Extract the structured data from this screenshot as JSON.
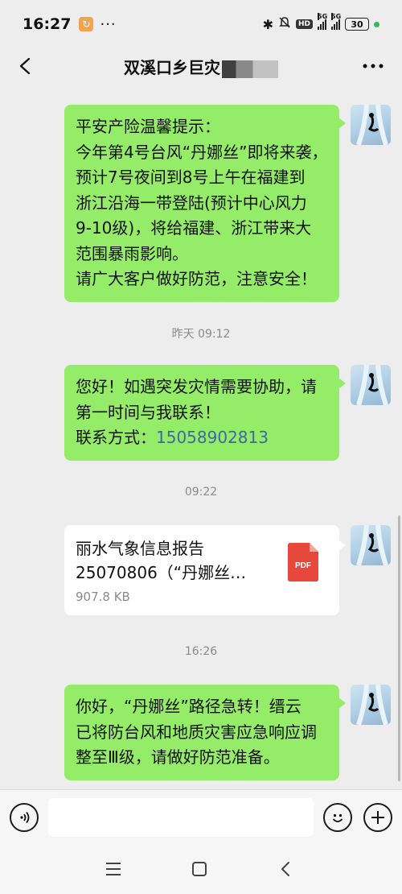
{
  "status_bar": {
    "time": "16:27",
    "dots": "···",
    "hd_label": "HD",
    "net1": "5G",
    "net2": "5G",
    "battery": "30"
  },
  "header": {
    "title": "双溪口乡巨",
    "title_partial": "灾"
  },
  "messages": [
    {
      "type": "text",
      "lines": [
        "平安产险温馨提示：",
        "今年第4号台风“丹娜丝”即将来袭，",
        "预计7号夜间到8号上午在福建到",
        "浙江沿海一带登陆(预计中心风力",
        "9-10级)，将给福建、浙江带来大",
        "范围暴雨影响。",
        "请广大客户做好防范，注意安全！"
      ]
    },
    {
      "type": "timestamp",
      "text": "昨天 09:12"
    },
    {
      "type": "text",
      "lines": [
        "您好！如遇突发灾情需要协助，请",
        "第一时间与我联系！"
      ],
      "contact_label": "联系方式：",
      "phone": "15058902813"
    },
    {
      "type": "timestamp",
      "text": "09:22"
    },
    {
      "type": "file",
      "name_line1": "丽水气象信息报告",
      "name_line2": "25070806（“丹娜丝…",
      "size": "907.8 KB",
      "file_type": "PDF"
    },
    {
      "type": "timestamp",
      "text": "16:26"
    },
    {
      "type": "text",
      "lines": [
        "你好，“丹娜丝”路径急转！缙云",
        "已将防台风和地质灾害应急响应调",
        "整至Ⅲ级，请做好防范准备。"
      ]
    }
  ],
  "input_bar": {
    "placeholder": ""
  },
  "colors": {
    "bubble_green": "#95ec69",
    "background": "#ededed",
    "pdf_red": "#e8473b",
    "phone_link": "#3a6aa6"
  },
  "icons": [
    "back-arrow-icon",
    "more-icon",
    "voice-icon",
    "emoji-icon",
    "plus-icon",
    "pdf-file-icon",
    "menu-icon",
    "home-icon",
    "back-icon"
  ]
}
